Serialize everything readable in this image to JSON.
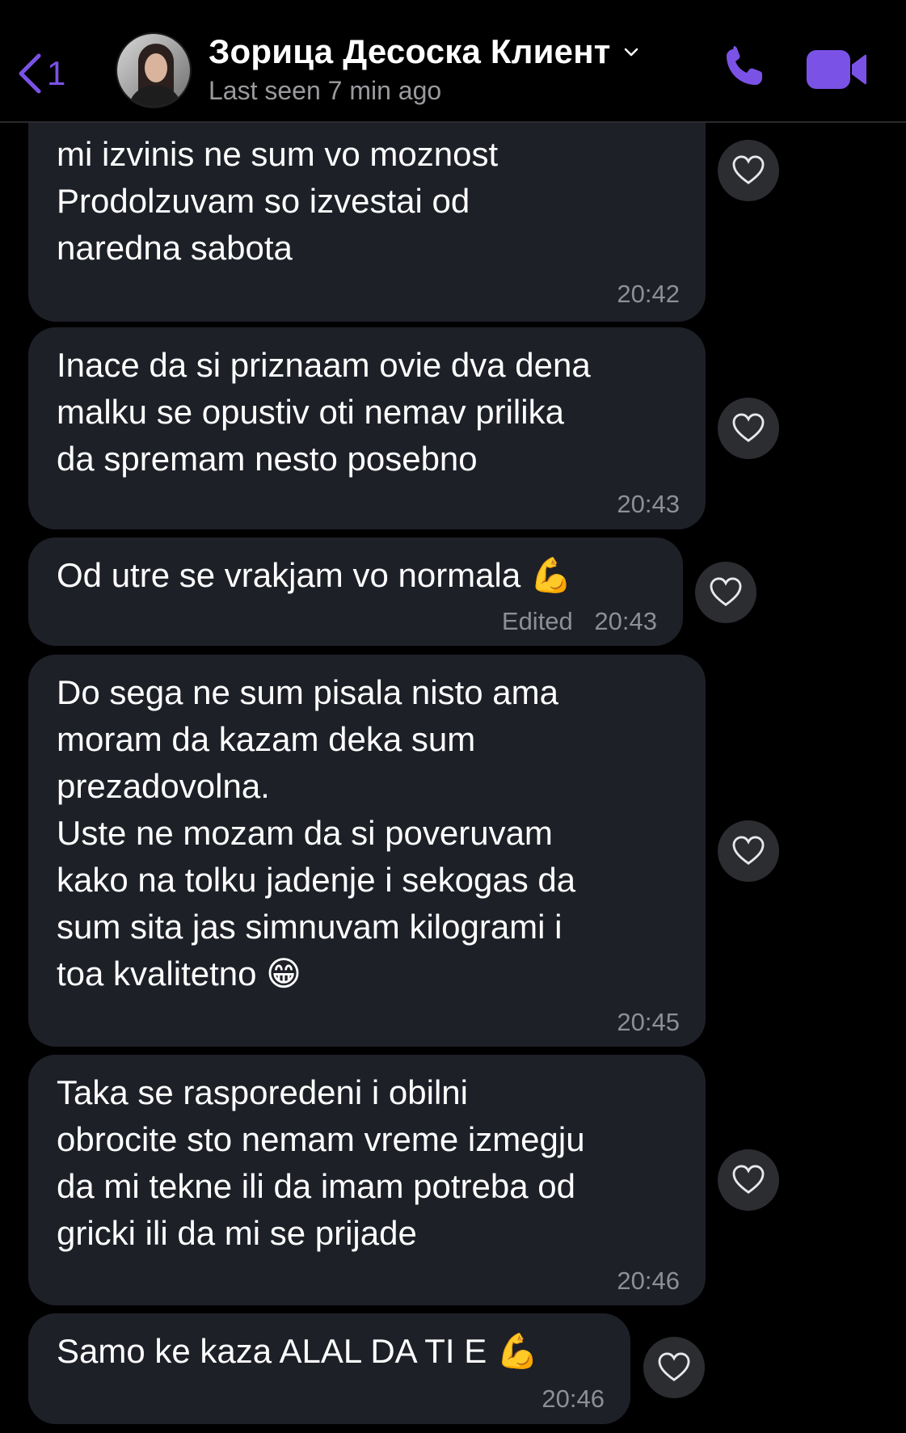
{
  "header": {
    "back_count": "1",
    "contact_name": "Зорица Десоска Клиент",
    "status": "Last seen 7 min ago"
  },
  "messages": [
    {
      "text": "mi izvinis ne sum vo moznost\nProdolzuvam so izvestai od\nnaredna sabota",
      "time": "20:42"
    },
    {
      "text": "Inace da si priznaam ovie dva dena\nmalku se opustiv oti nemav prilika\nda spremam nesto posebno",
      "time": "20:43"
    },
    {
      "text": "Od utre se vrakjam vo normala 💪",
      "edited": "Edited",
      "time": "20:43"
    },
    {
      "text": "Do sega ne sum pisala nisto ama\nmoram da kazam deka sum\nprezadovolna.\nUste ne mozam da si poveruvam\nkako na tolku jadenje i sekogas da\nsum sita jas simnuvam kilogrami i\ntoa kvalitetno 😁",
      "time": "20:45"
    },
    {
      "text": "Taka se rasporedeni i obilni\nobrocite sto nemam vreme izmegju\nda mi tekne ili da imam potreba od\ngricki ili da mi se prijade",
      "time": "20:46"
    },
    {
      "text": "Samo ke kaza ALAL DA TI E 💪",
      "time": "20:46"
    }
  ],
  "colors": {
    "accent": "#7b52e6",
    "bubble": "#1e2028",
    "background": "#000000",
    "meta": "#8e8f96"
  },
  "icons": [
    "back-chevron-icon",
    "chevron-down-icon",
    "phone-icon",
    "video-camera-icon",
    "heart-icon"
  ]
}
